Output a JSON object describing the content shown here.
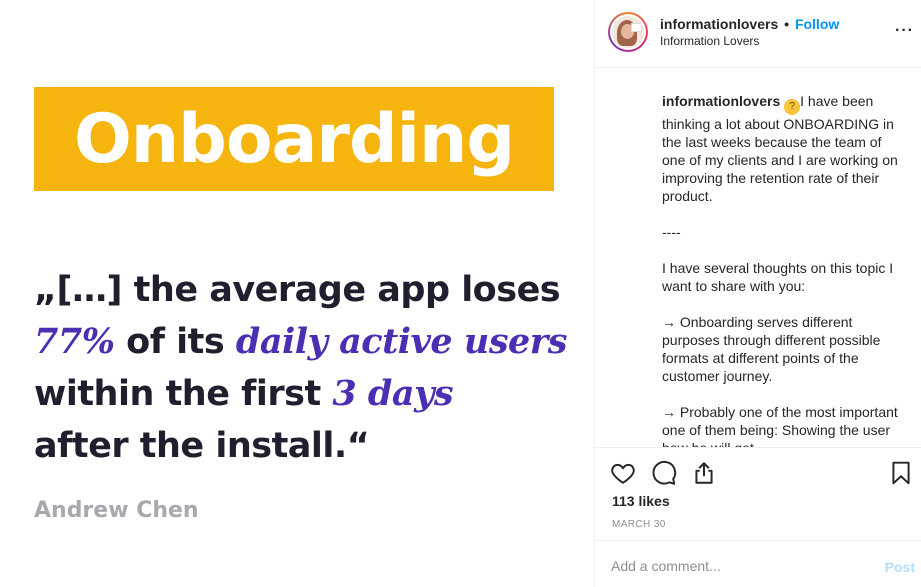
{
  "image": {
    "banner": "Onboarding",
    "quote_line1": "„[…] the average app loses",
    "quote_hl1": "77%",
    "quote_line2_rest": " of its ",
    "quote_hl2": "daily active users",
    "quote_line3_start": "within the first ",
    "quote_hl3": "3 days",
    "quote_line4": "after the install.“",
    "author": "Andrew Chen"
  },
  "header": {
    "username": "informationlovers",
    "separator": "•",
    "follow_label": "Follow",
    "subtitle": "Information Lovers",
    "more_label": "···"
  },
  "caption": {
    "username": "informationlovers",
    "emoji": "🤔",
    "p1": "I have been thinking a lot about ONBOARDING in the last weeks because the team of one of my clients and I are working on improving the retention rate of their product.",
    "p2": "----",
    "p3": "I have several thoughts on this topic I want to share with you:",
    "p4": "→ Onboarding serves different purposes through different possible formats at different points of the customer journey.",
    "p5": "→ Probably one of the most important one of them being: Showing the user how he will get"
  },
  "actions": {
    "likes": "113 likes",
    "date": "MARCH 30"
  },
  "comment": {
    "placeholder": "Add a comment...",
    "post_label": "Post"
  },
  "colors": {
    "banner": "#f6b40e",
    "highlight": "#4b2fb3",
    "follow": "#0095f6",
    "post_disabled": "#b2dffc"
  }
}
